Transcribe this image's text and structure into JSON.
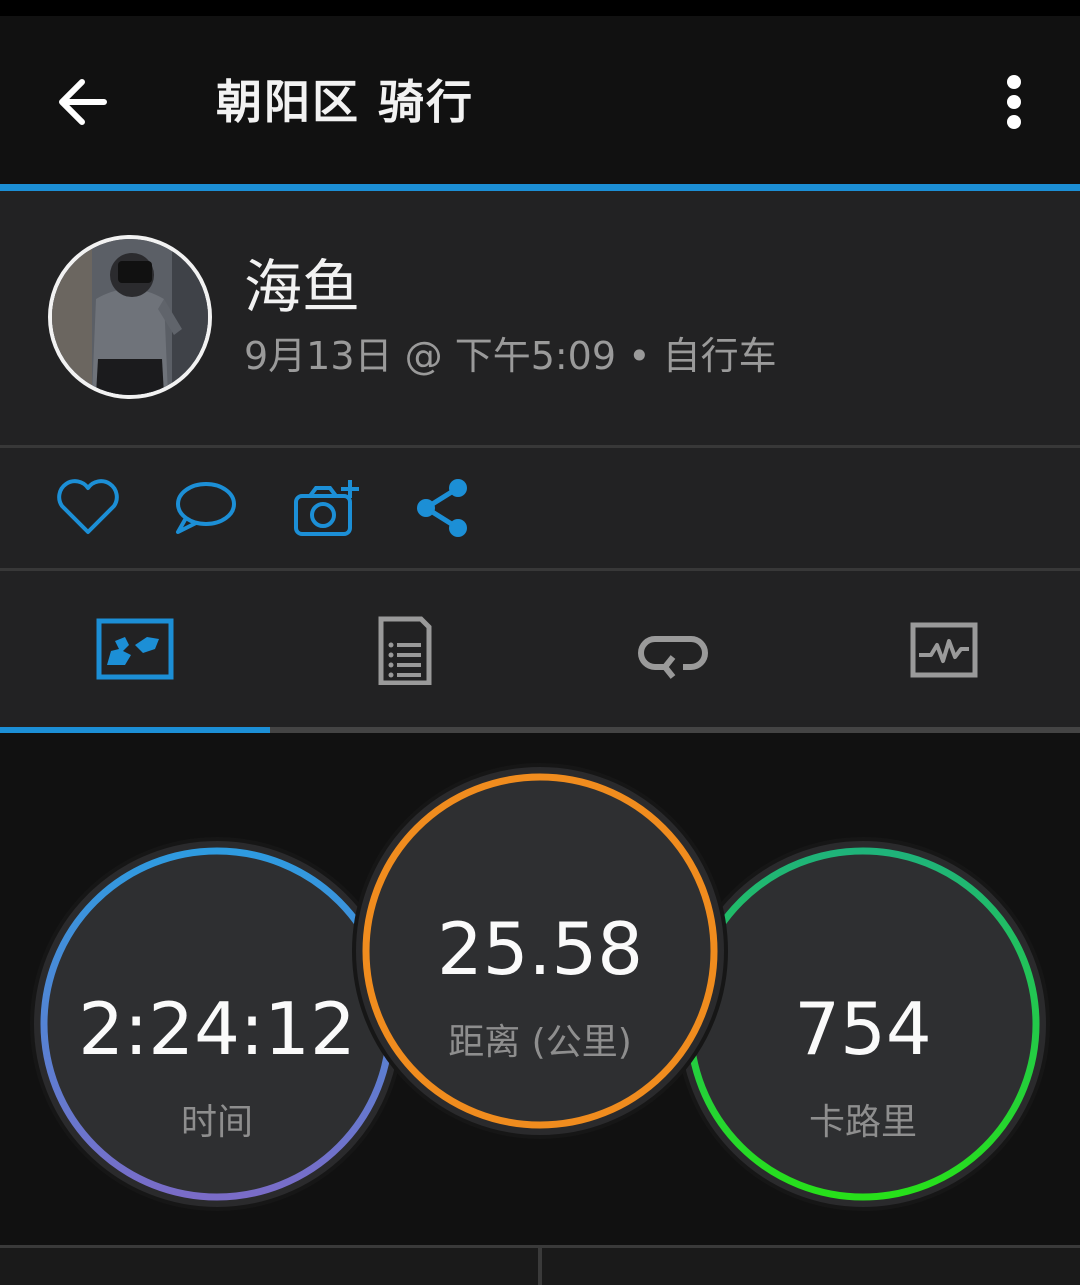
{
  "header": {
    "title": "朝阳区 骑行",
    "back_icon": "arrow-left-icon",
    "more_icon": "more-vertical-icon"
  },
  "colors": {
    "accent": "#1c8fd6",
    "time_ring": [
      "#2e9be0",
      "#7a6cc8"
    ],
    "distance_ring": "#f08c1e",
    "calories_ring": [
      "#1fb37a",
      "#27e01a"
    ]
  },
  "profile": {
    "name": "海鱼",
    "meta": "9月13日 @ 下午5:09 • 自行车"
  },
  "actions": [
    {
      "icon": "heart-icon"
    },
    {
      "icon": "comment-icon"
    },
    {
      "icon": "add-photo-icon"
    },
    {
      "icon": "share-icon"
    }
  ],
  "tabs": [
    {
      "icon": "map-icon",
      "active": true
    },
    {
      "icon": "document-list-icon",
      "active": false
    },
    {
      "icon": "laps-loop-icon",
      "active": false
    },
    {
      "icon": "chart-pulse-icon",
      "active": false
    }
  ],
  "stats": {
    "time": {
      "value": "2:24:12",
      "label": "时间"
    },
    "distance": {
      "value": "25.58",
      "label": "距离 (公里)"
    },
    "calories": {
      "value": "754",
      "label": "卡路里"
    }
  }
}
